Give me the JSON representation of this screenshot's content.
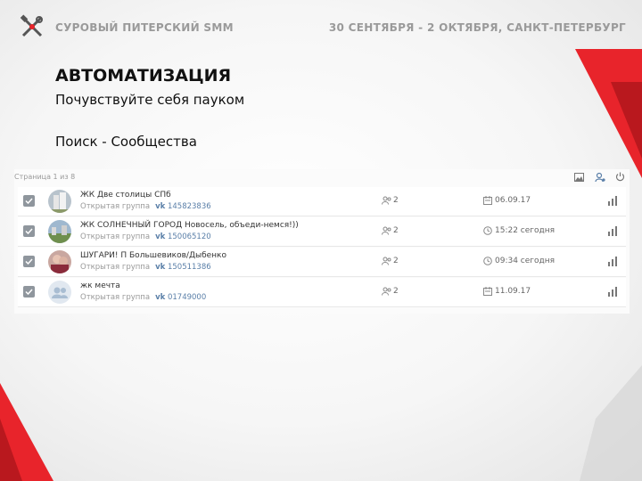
{
  "header": {
    "brand": "СУРОВЫЙ ПИТЕРСКИЙ SMM",
    "event": "30 СЕНТЯБРЯ - 2 ОКТЯБРЯ, САНКТ-ПЕТЕРБУРГ"
  },
  "slide": {
    "title": "АВТОМАТИЗАЦИЯ",
    "subtitle": "Почувствуйте себя пауком",
    "section": "Поиск - Сообщества"
  },
  "panel": {
    "pager": "Страница 1 из 8",
    "tools": [
      "image-icon",
      "user-settings-icon",
      "power-icon"
    ]
  },
  "rows": [
    {
      "name": "ЖК Две столицы СПб",
      "type": "Открытая группа",
      "vk": "vk",
      "gid": "145823836",
      "admins": "2",
      "date_icon": "calendar-icon",
      "date": "06.09.17",
      "avatar": "building",
      "checked": true
    },
    {
      "name": "ЖК СОЛНЕЧНЫЙ ГОРОД Новосель, объеди-немся!))",
      "type": "Открытая группа",
      "vk": "vk",
      "gid": "150065120",
      "admins": "2",
      "date_icon": "clock-icon",
      "date": "15:22 сегодня",
      "avatar": "landscape",
      "checked": true
    },
    {
      "name": "ШУГАРИ! П Большевиков/Дыбенко",
      "type": "Открытая группа",
      "vk": "vk",
      "gid": "150511386",
      "admins": "2",
      "date_icon": "clock-icon",
      "date": "09:34 сегодня",
      "avatar": "people",
      "checked": true
    },
    {
      "name": "жк мечта",
      "type": "Открытая группа",
      "vk": "vk",
      "gid": "01749000",
      "admins": "2",
      "date_icon": "calendar-icon",
      "date": "11.09.17",
      "avatar": "placeholder",
      "checked": true
    }
  ],
  "colors": {
    "accent_red": "#e8242b",
    "brand_gray": "#9a9a9a",
    "vk_blue": "#5a7fa8",
    "checkbox": "#8f969d"
  }
}
